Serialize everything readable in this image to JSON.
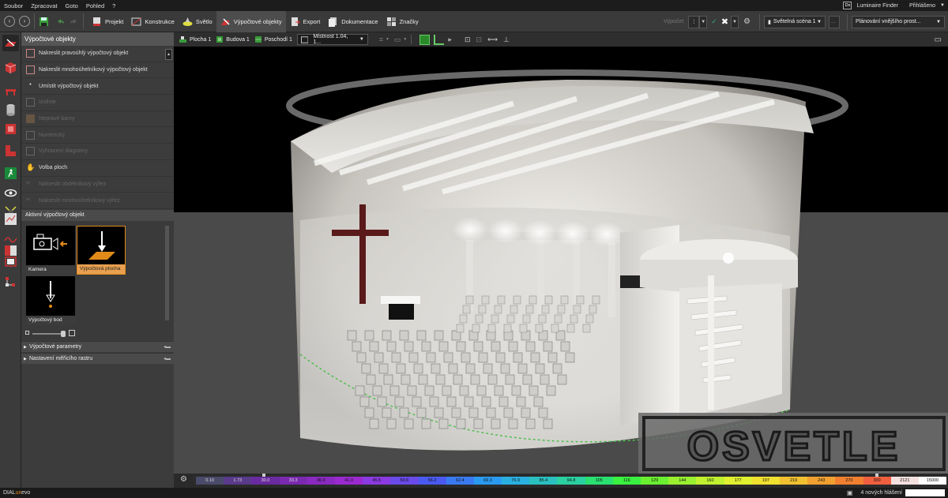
{
  "menu": {
    "items": [
      "Soubor",
      "Zpracovat",
      "Goto",
      "Pohled",
      "?"
    ],
    "finder_badge": "Dx",
    "luminaire_finder": "Luminaire Finder",
    "login": "Přihlášeno"
  },
  "toolbar": {
    "tabs": [
      "Projekt",
      "Konstrukce",
      "Světlo",
      "Výpočtové objekty",
      "Export",
      "Dokumentace",
      "Značky"
    ],
    "vypocet": "Výpočet",
    "scene": "Světelná scéna 1",
    "scene_more": "...",
    "planning": "Plánování vnějšího prost..."
  },
  "sidebar": {
    "title": "Výpočtové objekty",
    "options": [
      {
        "label": "Nakreslit pravoúhlý výpočtový objekt",
        "enabled": true
      },
      {
        "label": "Nakreslit mnohoúhelníkový výpočtový objekt",
        "enabled": true
      },
      {
        "label": "Umístit výpočtový objekt",
        "enabled": true
      },
      {
        "label": "Izolinie",
        "enabled": false
      },
      {
        "label": "Nepravé barvy",
        "enabled": false
      },
      {
        "label": "Numerický",
        "enabled": false
      },
      {
        "label": "Vyhrazení diagramy",
        "enabled": false
      },
      {
        "label": "Volba ploch",
        "enabled": true
      },
      {
        "label": "Nakreslit obdélníkový výřez",
        "enabled": false
      },
      {
        "label": "Nakreslit mnohoúhelníkový výřez",
        "enabled": false
      }
    ],
    "active_title": "Aktivní výpočtový objekt",
    "tiles": [
      {
        "label": "Kamera",
        "selected": false
      },
      {
        "label": "Výpočtová plocha",
        "selected": true
      },
      {
        "label": "Výpočtový bod",
        "selected": false
      }
    ],
    "accordions": [
      "Výpočtové parametry",
      "Nastavení měřicího rastru"
    ]
  },
  "viewport_bar": {
    "plocha": "Plocha 1",
    "budova": "Budova 1",
    "podlazi": "Poschodí 1",
    "room": "Místnost 1.04, 1..."
  },
  "scene": {
    "watermark": "OSVETLE"
  },
  "legend": {
    "values": [
      "0.10",
      "1.73",
      "30.0",
      "33.3",
      "36.9",
      "41.0",
      "45.5",
      "50.6",
      "56.2",
      "62.4",
      "69.3",
      "76.9",
      "85.4",
      "94.8",
      "105",
      "116",
      "129",
      "144",
      "160",
      "177",
      "197",
      "219",
      "243",
      "270",
      "300",
      "2121",
      "15000"
    ],
    "colors": [
      "#4a4a6a",
      "#5a3a8a",
      "#6a2aa0",
      "#7a2ab0",
      "#8a2ac0",
      "#9a2ad0",
      "#8a3ae0",
      "#6a4ae8",
      "#4a5af0",
      "#3a7af0",
      "#2a9af0",
      "#2ab0e0",
      "#2ac0c0",
      "#2ad0a0",
      "#2ae070",
      "#3af040",
      "#6af030",
      "#9af030",
      "#c0f030",
      "#e0f030",
      "#f0e030",
      "#f0c030",
      "#f0a030",
      "#f08030",
      "#f06040",
      "#f5e0e0",
      "#ffffff"
    ]
  },
  "status": {
    "app_dial": "DIAL",
    "app_lux": "ux",
    "app_evo": "evo",
    "messages": "4 nových hlášení"
  }
}
